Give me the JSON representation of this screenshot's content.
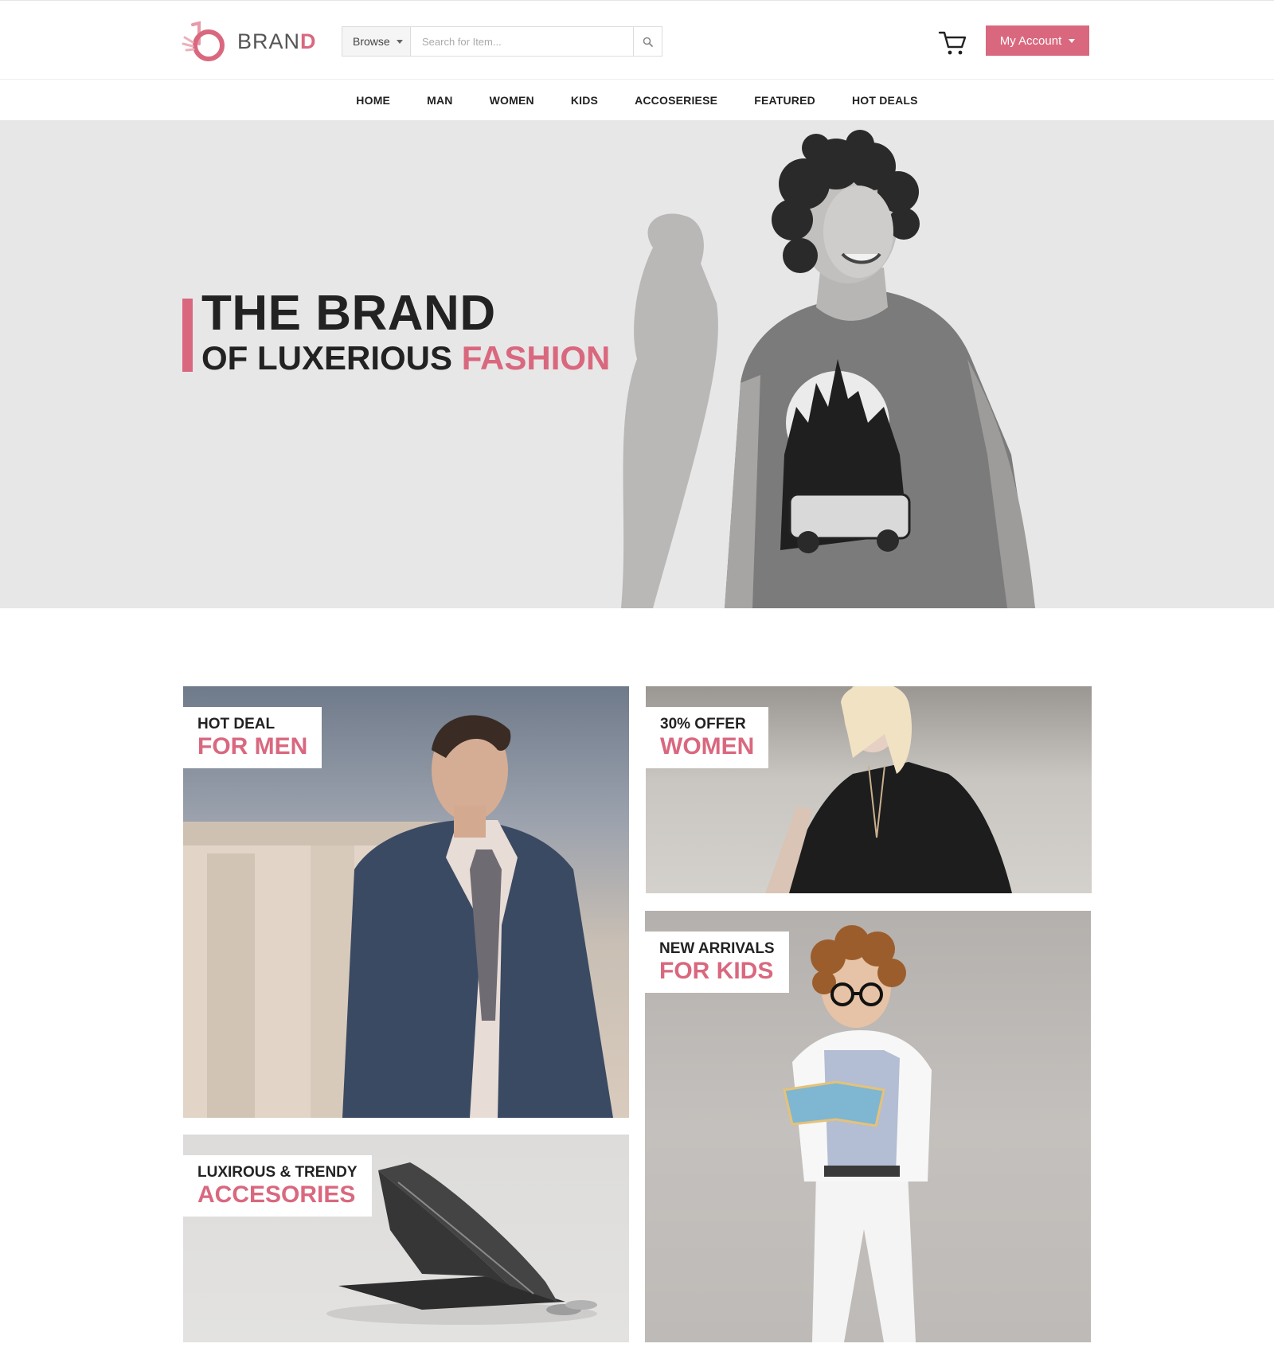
{
  "header": {
    "brand_regular": "BRAN",
    "brand_accent": "D",
    "browse_label": "Browse",
    "search_placeholder": "Search for Item...",
    "account_label": "My Account",
    "accent_color": "#d9687f"
  },
  "nav": {
    "items": [
      "HOME",
      "MAN",
      "WOMEN",
      "KIDS",
      "ACCOSERIESE",
      "FEATURED",
      "HOT DEALS"
    ]
  },
  "hero": {
    "line1": "THE BRAND",
    "line2_dark": "OF LUXERIOUS",
    "line2_accent": "FASHION"
  },
  "promos": {
    "men": {
      "small": "HOT DEAL",
      "big": "FOR MEN"
    },
    "women": {
      "small": "30% OFFER",
      "big": "WOMEN"
    },
    "kids": {
      "small": "NEW ARRIVALS",
      "big": "FOR KIDS"
    },
    "accessories": {
      "small": "LUXIROUS & TRENDY",
      "big": "ACCESORIES"
    }
  },
  "icons": {
    "logo": "brand-logo-icon",
    "search": "search-icon",
    "cart": "cart-icon",
    "caret": "caret-down-icon"
  }
}
